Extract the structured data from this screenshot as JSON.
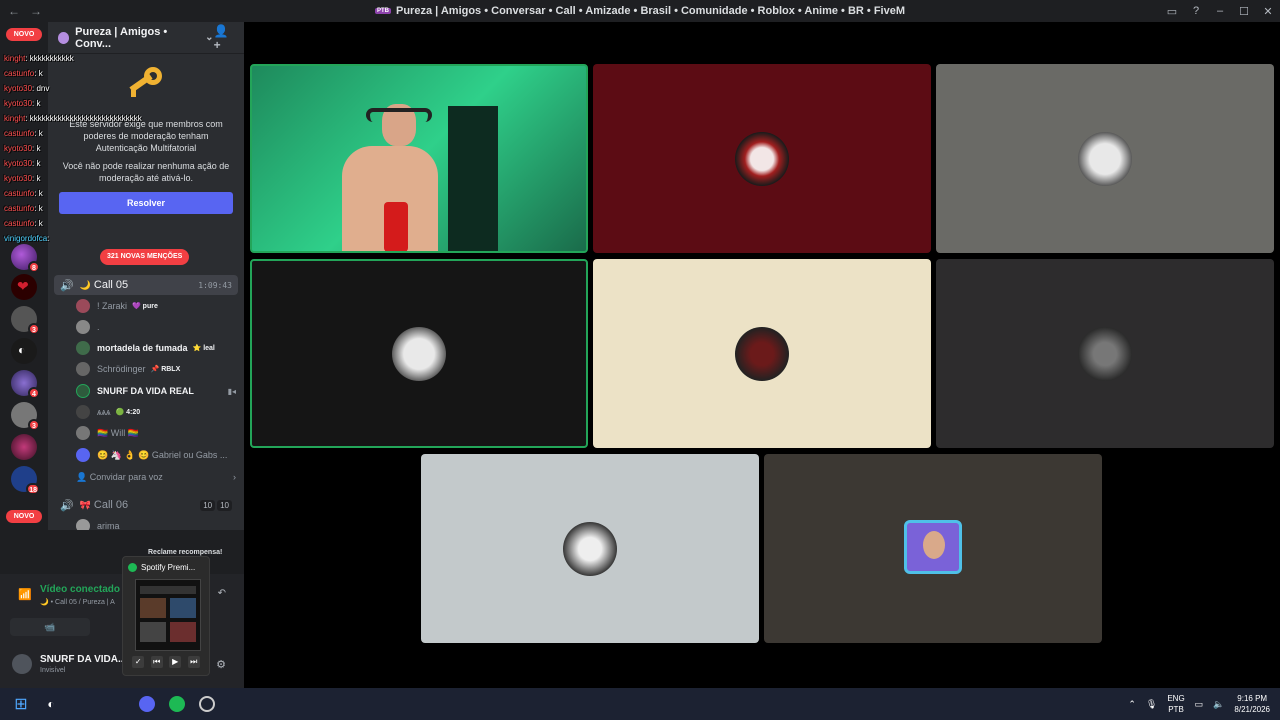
{
  "window": {
    "title_tag": "PTB",
    "title": "Pureza | Amigos • Conversar • Call • Amizade • Brasil • Comunidade • Roblox • Anime • BR • FiveM",
    "back": "←",
    "forward": "→",
    "minimize": "–",
    "maximize": "☐",
    "close": "✕"
  },
  "rail": {
    "novo_top": "NOVO",
    "novo_bottom": "NOVO",
    "servers": [
      {
        "badge": ""
      },
      {
        "badge": "8"
      },
      {
        "badge": ""
      },
      {
        "badge": "3"
      },
      {
        "badge": ""
      },
      {
        "badge": "4"
      },
      {
        "badge": "3"
      },
      {
        "badge": ""
      },
      {
        "badge": "18"
      },
      {
        "badge": ""
      }
    ]
  },
  "guild": {
    "name": "Pureza | Amigos • Conv...",
    "chevron": "⌄",
    "invite_icon": "👤+"
  },
  "mfa": {
    "line1": "Este servidor exige que membros com poderes de moderação tenham Autenticação Multifatorial",
    "line2": "Você não pode realizar nenhuma ação de moderação até ativá-lo.",
    "button": "Resolver"
  },
  "mentions": "321 NOVAS MENÇÕES",
  "channels": {
    "call05": {
      "name": "Call 05",
      "time": "1:09:43"
    },
    "call06": {
      "name": "Call 06",
      "count_a": "10",
      "count_b": "10"
    },
    "invite": "Convidar para voz",
    "users": [
      {
        "name": "! Zaraki",
        "tag": "💜 pure"
      },
      {
        "name": ".",
        "tag": ""
      },
      {
        "name": "mortadela de fumada",
        "tag": "⭐ leal"
      },
      {
        "name": "Schrödinger",
        "tag": "📌 RBLX"
      },
      {
        "name": "SNURF DA VIDA REAL",
        "tag": ""
      },
      {
        "name": "ѧѧѧ",
        "tag": "🟢 4:20"
      },
      {
        "name": "🏳️‍🌈 Will 🏳️‍🌈",
        "tag": ""
      },
      {
        "name": "😊 🦄 👌 😊 Gabriel ou Gabs ...",
        "tag": ""
      },
      {
        "name": "arima",
        "tag": ""
      }
    ]
  },
  "chat": [
    {
      "user": "kinght",
      "text": ": kkkkkkkkkkk"
    },
    {
      "user": "castunfo",
      "text": ": k"
    },
    {
      "user": "kyoto30",
      "text": ": dnv"
    },
    {
      "user": "kyoto30",
      "text": ": k"
    },
    {
      "user": "kinght",
      "text": ": kkkkkkkkkkkkkkkkkkkkkkkkkkkk"
    },
    {
      "user": "castunfo",
      "text": ": k"
    },
    {
      "user": "kyoto30",
      "text": ": k"
    },
    {
      "user": "kyoto30",
      "text": ": k"
    },
    {
      "user": "kyoto30",
      "text": ": k"
    },
    {
      "user": "castunfo",
      "text": ": k"
    },
    {
      "user": "castunfo",
      "text": ": k"
    },
    {
      "user": "castunfo",
      "text": ": k"
    },
    {
      "user": "vinigordofca",
      "text": ": "
    }
  ],
  "voice": {
    "status": "Vídeo conectado",
    "sub": "🌙 • Call 05 / Pureza | A",
    "cam_icon": "📹"
  },
  "user": {
    "name": "SNURF DA VIDA...",
    "status": "Invisível"
  },
  "promo": "Reclame recompensa!",
  "spotify": {
    "title": "Spotify Premi..."
  },
  "tray": {
    "lang1": "ENG",
    "lang2": "PTB",
    "time": "9:16 PM",
    "date": "8/21/2026"
  }
}
